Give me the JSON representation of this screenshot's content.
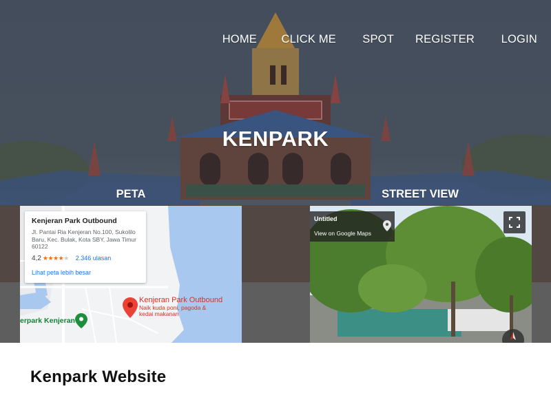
{
  "nav": {
    "items": [
      "HOME",
      "CLICK ME",
      "SPOT",
      "REGISTER",
      "LOGIN"
    ]
  },
  "hero": {
    "title": "KENPARK"
  },
  "sections": {
    "map_label": "PETA",
    "streetview_label": "STREET VIEW"
  },
  "map": {
    "card_title": "Kenjeran Park Outbound",
    "card_address": "Jl. Pantai Ria Kenjeran No.100, Sukolilo Baru, Kec. Bulak, Kota SBY, Jawa Timur 60122",
    "rating": "4,2",
    "rating_fraction": 0.84,
    "reviews": "2.346 ulasan",
    "bigger_map": "Lihat peta lebih besar",
    "pin_title": "Kenjeran Park Outbound",
    "pin_subtitle": "Naik kuda poni, pagoda & kedai makanan",
    "place_label": "erpark Kenjeran"
  },
  "streetview": {
    "title": "Untitled",
    "link": "View on Google Maps"
  },
  "footer": {
    "title": "Kenpark Website"
  },
  "colors": {
    "map_water": "#a8c8f0",
    "map_land": "#f1f3f4",
    "pin_red": "#d93025",
    "link_blue": "#1a73e8",
    "star_orange": "#e7711b",
    "place_green": "#188038"
  }
}
